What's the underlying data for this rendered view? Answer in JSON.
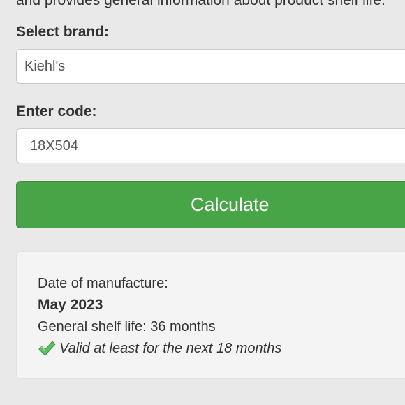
{
  "intro_text": "and provides general information about product shelf life.",
  "form": {
    "brand_label": "Select brand:",
    "brand_value": "Kiehl's",
    "code_label": "Enter code:",
    "code_value": "18X504",
    "calculate_label": "Calculate"
  },
  "result": {
    "manufacture_label": "Date of manufacture:",
    "manufacture_date": "May 2023",
    "shelf_life_text": "General shelf life: 36 months",
    "validity_text": "Valid at least for the next 18 months",
    "validity_icon": "check-mark-icon"
  },
  "colors": {
    "button": "#47a447",
    "check": "#5cc15c",
    "background": "#e9e9e9"
  }
}
